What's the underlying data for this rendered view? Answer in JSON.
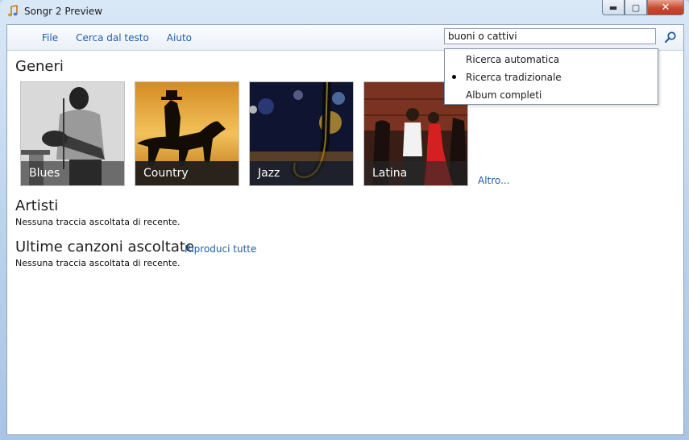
{
  "window": {
    "title": "Songr 2 Preview",
    "minimize": "▬",
    "maximize": "▢",
    "close": "✕"
  },
  "menu": {
    "items": [
      "File",
      "Cerca dal testo",
      "Aiuto"
    ]
  },
  "search": {
    "value": "buoni o cattivi",
    "icon": "search-icon"
  },
  "search_modes": {
    "items": [
      {
        "label": "Ricerca automatica",
        "selected": false
      },
      {
        "label": "Ricerca tradizionale",
        "selected": true
      },
      {
        "label": "Album completi",
        "selected": false
      }
    ]
  },
  "genres": {
    "title": "Generi",
    "tiles": [
      {
        "label": "Blues"
      },
      {
        "label": "Country"
      },
      {
        "label": "Jazz"
      },
      {
        "label": "Latina"
      }
    ],
    "more": "Altro..."
  },
  "artists": {
    "title": "Artisti",
    "empty": "Nessuna traccia ascoltata di recente."
  },
  "recent": {
    "title": "Ultime canzoni ascoltate",
    "play_all": "Riproduci tutte",
    "empty": "Nessuna traccia ascoltata di recente."
  }
}
